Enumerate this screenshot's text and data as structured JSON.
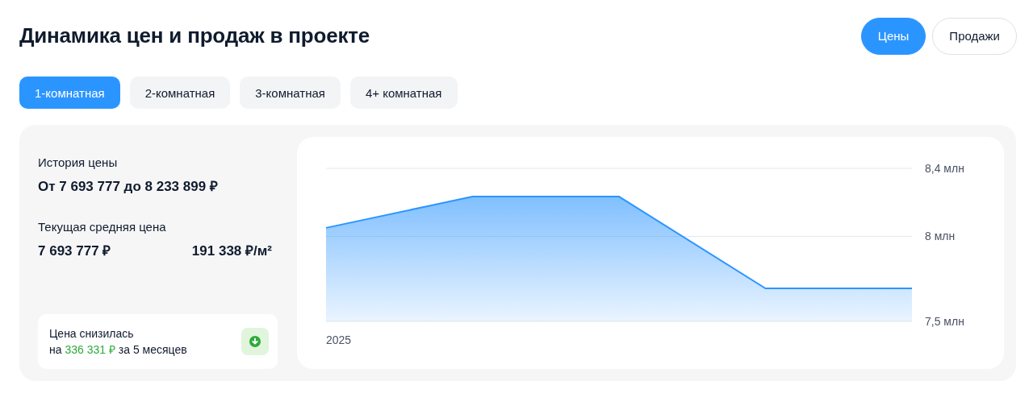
{
  "title": "Динамика цен и продаж в проекте",
  "view_toggle": [
    {
      "label": "Цены",
      "selected": true
    },
    {
      "label": "Продажи",
      "selected": false
    }
  ],
  "room_tabs": [
    {
      "label": "1-комнатная",
      "selected": true
    },
    {
      "label": "2-комнатная",
      "selected": false
    },
    {
      "label": "3-комнатная",
      "selected": false
    },
    {
      "label": "4+ комнатная",
      "selected": false
    }
  ],
  "summary": {
    "history_label": "История цены",
    "history_value": "От 7 693 777 до 8 233 899 ₽",
    "current_label": "Текущая средняя цена",
    "current_price": "7 693 777 ₽",
    "price_per_m2": "191 338 ₽/м²",
    "notice": {
      "line1": "Цена снизилась",
      "line2": "на **336 331 ₽** за 5 месяцев"
    }
  },
  "chart_year": "2025",
  "chart_data": {
    "type": "area",
    "ylim": [
      7.5,
      8.4
    ],
    "yticks": [
      {
        "value": 8.4,
        "label": "8,4 млн"
      },
      {
        "value": 8,
        "label": "8 млн"
      },
      {
        "value": 7.5,
        "label": "7,5 млн"
      }
    ],
    "series": [
      {
        "color": "#2b95ff",
        "values": [
          8.05,
          8.234,
          8.234,
          7.694,
          7.694
        ]
      }
    ]
  }
}
